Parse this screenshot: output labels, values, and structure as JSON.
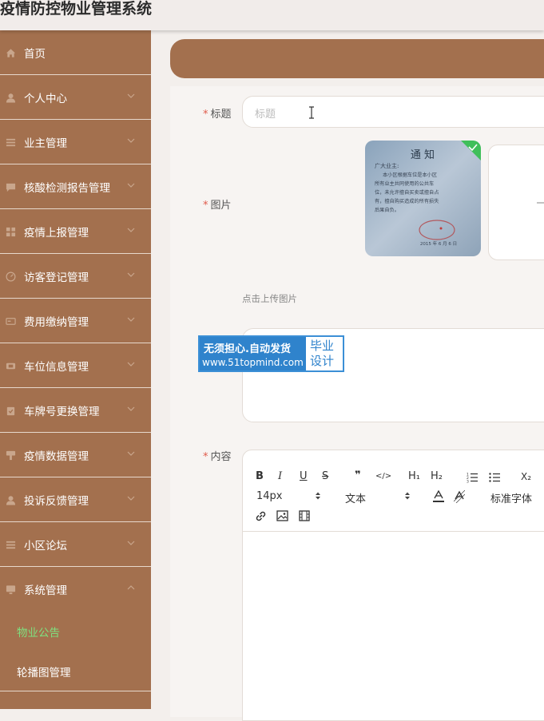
{
  "app": {
    "title": "疫情防控物业管理系统"
  },
  "sidebar": {
    "items": [
      {
        "label": "首页",
        "icon": "home-icon"
      },
      {
        "label": "个人中心",
        "icon": "user-icon"
      },
      {
        "label": "业主管理",
        "icon": "list-icon"
      },
      {
        "label": "核酸检测报告管理",
        "icon": "chat-icon"
      },
      {
        "label": "疫情上报管理",
        "icon": "grid-icon"
      },
      {
        "label": "访客登记管理",
        "icon": "gauge-icon"
      },
      {
        "label": "费用缴纳管理",
        "icon": "card-icon"
      },
      {
        "label": "车位信息管理",
        "icon": "parking-icon"
      },
      {
        "label": "车牌号更换管理",
        "icon": "clipboard-icon"
      },
      {
        "label": "疫情数据管理",
        "icon": "brush-icon"
      },
      {
        "label": "投诉反馈管理",
        "icon": "user-icon"
      },
      {
        "label": "小区论坛",
        "icon": "list-icon"
      },
      {
        "label": "系统管理",
        "icon": "monitor-icon"
      }
    ],
    "sub_items": [
      {
        "label": "物业公告",
        "active": true
      },
      {
        "label": "轮播图管理",
        "active": false
      }
    ]
  },
  "form": {
    "title_label": "标题",
    "title_placeholder": "标题",
    "image_label": "图片",
    "upload_hint": "点击上传图片",
    "content_label": "内容",
    "image_thumb_text": {
      "heading": "通  知",
      "greeting": "广大业主:",
      "body": "本小区根据车位是本小区所有业主共同使用的公共车位，未允许擅自买卖或擅自占有，擅自购买造成的所有损失后果自负。",
      "date": "2015 年 6 月 6 日"
    }
  },
  "watermark": {
    "line1": "无须担心.自动发货",
    "line2": "www.51topmind.com",
    "badge_line1": "毕业",
    "badge_line2": "设计"
  },
  "editor": {
    "toolbar": {
      "bold": "B",
      "italic": "I",
      "underline": "U",
      "strike": "S",
      "quote": "❞",
      "code": "</>",
      "h1": "H₁",
      "h2": "H₂",
      "sub": "X₂",
      "font_size": "14px",
      "header_select": "文本",
      "font_family": "标准字体"
    }
  },
  "colors": {
    "sidebar_bg": "#a3704e",
    "active_sub": "#7fe07f",
    "required": "#e05a4a",
    "upload_check": "#3fbf5a"
  }
}
